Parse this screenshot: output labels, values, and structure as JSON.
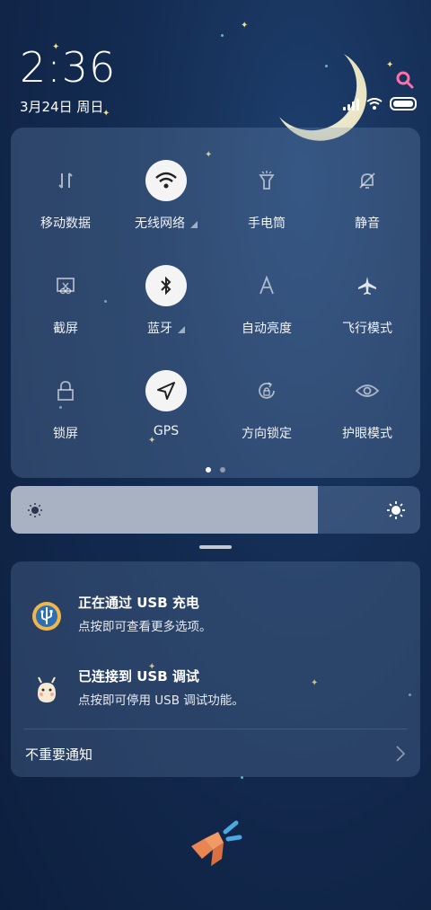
{
  "status": {
    "time": "2:36",
    "date": "3月24日 周日"
  },
  "quick_settings": {
    "tiles": [
      {
        "label": "移动数据",
        "icon": "mobile-data-icon",
        "active": false
      },
      {
        "label": "无线网络",
        "icon": "wifi-icon",
        "active": true
      },
      {
        "label": "手电筒",
        "icon": "flashlight-icon",
        "active": false
      },
      {
        "label": "静音",
        "icon": "mute-icon",
        "active": false
      },
      {
        "label": "截屏",
        "icon": "screenshot-icon",
        "active": false
      },
      {
        "label": "蓝牙",
        "icon": "bluetooth-icon",
        "active": true
      },
      {
        "label": "自动亮度",
        "icon": "auto-brightness-icon",
        "active": false
      },
      {
        "label": "飞行模式",
        "icon": "airplane-icon",
        "active": false
      },
      {
        "label": "锁屏",
        "icon": "lock-icon",
        "active": false
      },
      {
        "label": "GPS",
        "icon": "gps-icon",
        "active": true
      },
      {
        "label": "方向锁定",
        "icon": "rotation-lock-icon",
        "active": false
      },
      {
        "label": "护眼模式",
        "icon": "eye-icon",
        "active": false
      }
    ],
    "page_count": 2,
    "current_page": 1
  },
  "brightness": {
    "level": 0.75
  },
  "notifications": [
    {
      "title": "正在通过 USB 充电",
      "text": "点按即可查看更多选项。",
      "icon": "usb-icon"
    },
    {
      "title": "已连接到 USB 调试",
      "text": "点按即可停用 USB 调试功能。",
      "icon": "android-debug-icon"
    }
  ],
  "minor_notifications": {
    "label": "不重要通知"
  }
}
